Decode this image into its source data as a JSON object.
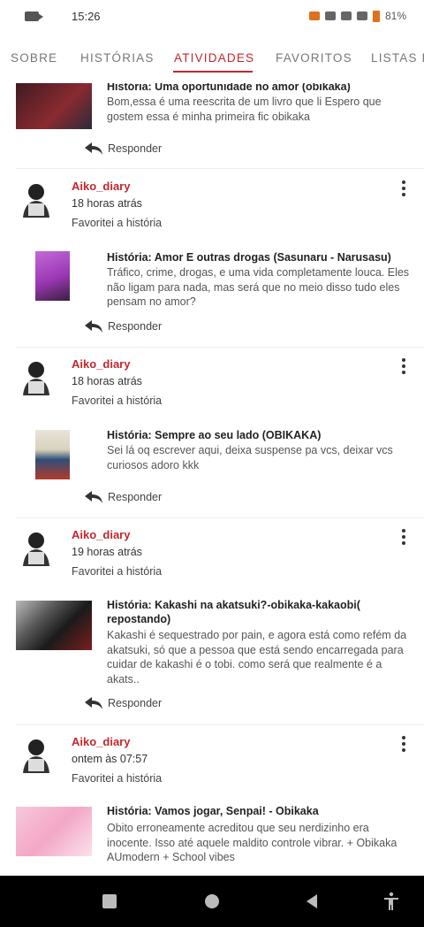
{
  "status": {
    "time": "15:26",
    "battery": "81%"
  },
  "tabs": [
    {
      "label": "SOBRE"
    },
    {
      "label": "HISTÓRIAS"
    },
    {
      "label": "ATIVIDADES"
    },
    {
      "label": "FAVORITOS"
    },
    {
      "label": "LISTAS D"
    }
  ],
  "feed": {
    "top_story": {
      "title": "História: Uma oportunidade no amor (obikaka)",
      "desc": "Bom,essa é uma reescrita de um livro que li Espero que gostem essa é minha primeira fic obikaka",
      "reply": "Responder"
    },
    "items": [
      {
        "user": "Aiko_diary",
        "time": "18 horas atrás",
        "action": "Favoritei a história",
        "story_title": "História: Amor E outras drogas (Sasunaru - Narusasu)",
        "story_desc": "Tráfico, crime, drogas,  e uma vida completamente louca. Eles não ligam para nada, mas será que no meio disso tudo eles pensam no amor?",
        "reply": "Responder"
      },
      {
        "user": "Aiko_diary",
        "time": "18 horas atrás",
        "action": "Favoritei a história",
        "story_title": "História: Sempre ao seu lado (OBIKAKA)",
        "story_desc": "Sei lá oq escrever aqui, deixa suspense pa vcs, deixar vcs curiosos adoro kkk",
        "reply": "Responder"
      },
      {
        "user": "Aiko_diary",
        "time": "19 horas atrás",
        "action": "Favoritei a história",
        "story_title": "História: Kakashi na akatsuki?-obikaka-kakaobi( repostando)",
        "story_desc": "Kakashi é sequestrado por pain, e agora está como refém da akatsuki, só que a pessoa que está sendo encarregada para cuidar de kakashi é o tobi. como será que realmente é a akats..",
        "reply": "Responder"
      },
      {
        "user": "Aiko_diary",
        "time": "ontem às 07:57",
        "action": "Favoritei a história",
        "story_title": "História: Vamos jogar, Senpai! - Obikaka",
        "story_desc": "Obito erroneamente acreditou que seu nerdizinho era inocente. Isso até aquele maldito controle vibrar.  + Obikaka AUmodern + School vibes",
        "reply": ""
      }
    ]
  }
}
